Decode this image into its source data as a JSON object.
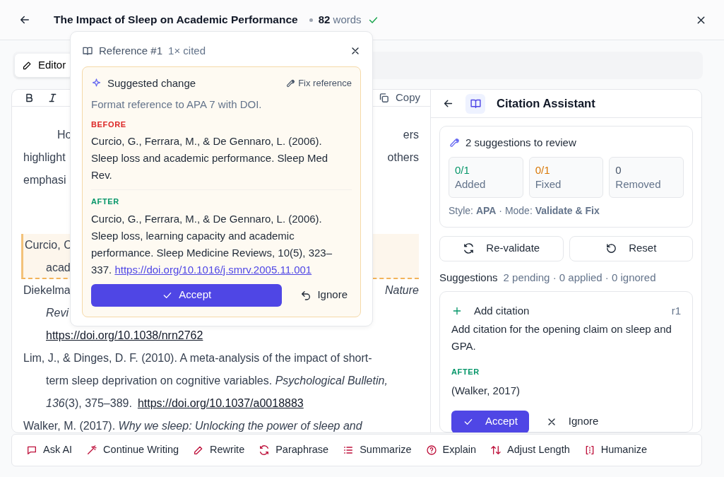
{
  "header": {
    "title": "The Impact of Sleep on Academic Performance",
    "word_count": "82",
    "word_label": "words",
    "saved": true
  },
  "mode_tab": {
    "label": "Editor",
    "selected": true
  },
  "editor_toolbar": {
    "copy": "Copy"
  },
  "document": [
    {
      "kind": "first",
      "highlighted": false,
      "left": "Ho",
      "right": "ers"
    },
    {
      "kind": "line",
      "highlighted": false,
      "left": "highlight",
      "right": "others"
    },
    {
      "kind": "line",
      "highlighted": false,
      "left": "emphasi"
    },
    {
      "kind": "blank",
      "highlighted": false
    },
    {
      "kind": "line",
      "highlighted": true,
      "left": "Curcio, C"
    },
    {
      "kind": "hanging",
      "highlighted": true,
      "left": "acad"
    },
    {
      "kind": "line",
      "highlighted": false,
      "left": "Diekelma",
      "right": "*Nature*"
    },
    {
      "kind": "hanging",
      "highlighted": false,
      "left": "*Revi*"
    },
    {
      "kind": "hanging",
      "highlighted": false,
      "link": "https://doi.org/10.1038/nrn2762"
    },
    {
      "kind": "line",
      "highlighted": false,
      "left": "Lim, J., & Dinges, D. F. (2010). A meta-analysis of the impact of short-"
    },
    {
      "kind": "hanging",
      "highlighted": false,
      "left": "term sleep deprivation on cognitive variables. *Psychological Bulletin,*"
    },
    {
      "kind": "hanging",
      "highlighted": false,
      "left": "*136*(3), 375–389.",
      "link": "https://doi.org/10.1037/a0018883"
    },
    {
      "kind": "line",
      "highlighted": false,
      "left": "Walker, M. (2017). *Why we sleep: Unlocking the power of sleep and*"
    }
  ],
  "popover": {
    "title": "Reference #1",
    "cited": "1× cited",
    "suggestion_title": "Suggested change",
    "action": "Fix reference",
    "description": "Format reference to APA 7 with DOI.",
    "before_label": "BEFORE",
    "before": "Curcio, G., Ferrara, M., & De Gennaro, L. (2006). Sleep loss and academic performance. Sleep Med Rev.",
    "after_label": "AFTER",
    "after": "Curcio, G., Ferrara, M., & De Gennaro, L. (2006). Sleep loss, learning capacity and academic performance. Sleep Medicine Reviews, 10(5), 323–337.",
    "after_link": "https://doi.org/10.1016/j.smrv.2005.11.001",
    "accept": "Accept",
    "ignore": "Ignore"
  },
  "panel": {
    "title": "Citation Assistant",
    "summary": "2 suggestions to review",
    "stats": [
      {
        "value": "0/1",
        "label": "Added",
        "color": "#059669"
      },
      {
        "value": "0/1",
        "label": "Fixed",
        "color": "#d97706"
      },
      {
        "value": "0",
        "label": "Removed",
        "color": "#475569"
      }
    ],
    "style_line": "Style: **APA** · Mode: **Validate & Fix**",
    "revalidate": "Re-validate",
    "reset": "Reset",
    "suggestions_label": "Suggestions",
    "suggestions_counts": "2 pending · 0 applied · 0 ignored",
    "suggestion": {
      "kind": "add",
      "title": "Add citation",
      "ref": "r1",
      "description": "Add citation for the opening claim on sleep and GPA.",
      "after_label": "AFTER",
      "after": "(Walker, 2017)",
      "accept": "Accept",
      "ignore": "Ignore"
    }
  },
  "actions": [
    {
      "kind": "chat",
      "label": "Ask AI"
    },
    {
      "kind": "wand",
      "label": "Continue Writing"
    },
    {
      "kind": "pen",
      "label": "Rewrite"
    },
    {
      "kind": "cycle",
      "label": "Paraphrase"
    },
    {
      "kind": "list",
      "label": "Summarize"
    },
    {
      "kind": "help",
      "label": "Explain"
    },
    {
      "kind": "updown",
      "label": "Adjust Length"
    },
    {
      "kind": "frame",
      "label": "Humanize"
    }
  ]
}
